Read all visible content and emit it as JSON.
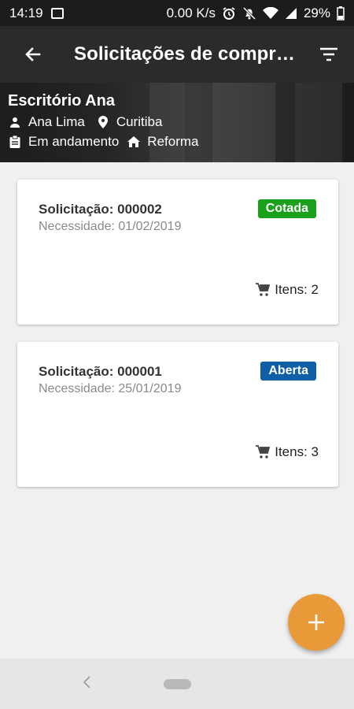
{
  "status_bar": {
    "time": "14:19",
    "speed": "0.00 K/s",
    "battery": "29%"
  },
  "app_bar": {
    "title": "Solicitações de compr…",
    "back_icon": "arrow-left-icon",
    "filter_icon": "filter-icon"
  },
  "banner": {
    "name": "Escritório Ana",
    "person": "Ana Lima",
    "location": "Curitiba",
    "status": "Em andamento",
    "type": "Reforma"
  },
  "requests": [
    {
      "number": "Solicitação: 000002",
      "need": "Necessidade: 01/02/2019",
      "badge": "Cotada",
      "badge_color": "#1aa01a",
      "items": "Itens: 2"
    },
    {
      "number": "Solicitação: 000001",
      "need": "Necessidade: 25/01/2019",
      "badge": "Aberta",
      "badge_color": "#0e5fa6",
      "items": "Itens: 3"
    }
  ],
  "fab": {
    "icon": "plus-icon",
    "color": "#e89a38"
  }
}
